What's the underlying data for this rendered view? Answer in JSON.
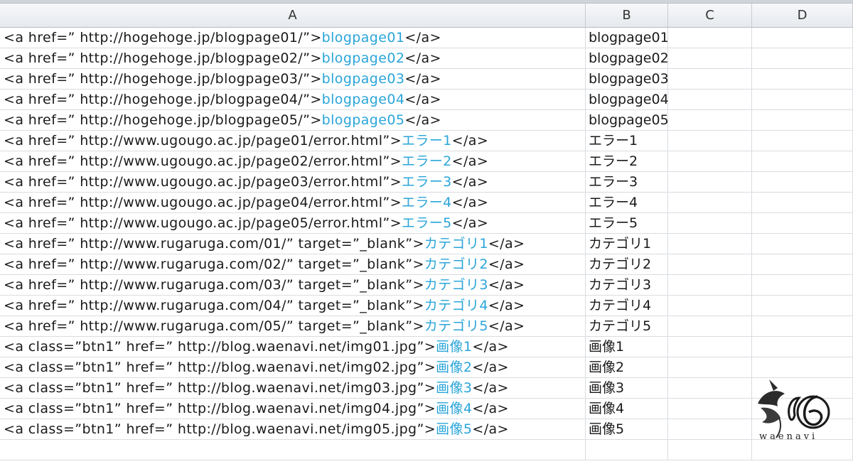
{
  "columns": [
    "A",
    "B",
    "C",
    "D"
  ],
  "rows": [
    {
      "pre": "<a href=” http://hogehoge.jp/blogpage01/”>",
      "link": "blogpage01",
      "post": "</a>",
      "b": "blogpage01"
    },
    {
      "pre": "<a href=” http://hogehoge.jp/blogpage02/”>",
      "link": "blogpage02",
      "post": "</a>",
      "b": "blogpage02"
    },
    {
      "pre": "<a href=” http://hogehoge.jp/blogpage03/”>",
      "link": "blogpage03",
      "post": "</a>",
      "b": "blogpage03"
    },
    {
      "pre": "<a href=” http://hogehoge.jp/blogpage04/”>",
      "link": "blogpage04",
      "post": "</a>",
      "b": "blogpage04"
    },
    {
      "pre": "<a href=” http://hogehoge.jp/blogpage05/”>",
      "link": "blogpage05",
      "post": "</a>",
      "b": "blogpage05"
    },
    {
      "pre": "<a href=” http://www.ugougo.ac.jp/page01/error.html”>",
      "link": "エラー1",
      "post": "</a>",
      "b": "エラー1"
    },
    {
      "pre": "<a href=” http://www.ugougo.ac.jp/page02/error.html”>",
      "link": "エラー2",
      "post": "</a>",
      "b": "エラー2"
    },
    {
      "pre": "<a href=” http://www.ugougo.ac.jp/page03/error.html”>",
      "link": "エラー3",
      "post": "</a>",
      "b": "エラー3"
    },
    {
      "pre": "<a href=” http://www.ugougo.ac.jp/page04/error.html”>",
      "link": "エラー4",
      "post": "</a>",
      "b": "エラー4"
    },
    {
      "pre": "<a href=” http://www.ugougo.ac.jp/page05/error.html”>",
      "link": "エラー5",
      "post": "</a>",
      "b": "エラー5"
    },
    {
      "pre": "<a href=” http://www.rugaruga.com/01/”  target=”_blank”>",
      "link": "カテゴリ1",
      "post": "</a>",
      "b": "カテゴリ1"
    },
    {
      "pre": "<a href=” http://www.rugaruga.com/02/”  target=”_blank”>",
      "link": "カテゴリ2",
      "post": "</a>",
      "b": "カテゴリ2"
    },
    {
      "pre": "<a href=” http://www.rugaruga.com/03/”  target=”_blank”>",
      "link": "カテゴリ3",
      "post": "</a>",
      "b": "カテゴリ3"
    },
    {
      "pre": "<a href=” http://www.rugaruga.com/04/”  target=”_blank”>",
      "link": "カテゴリ4",
      "post": "</a>",
      "b": "カテゴリ4"
    },
    {
      "pre": "<a href=” http://www.rugaruga.com/05/”  target=”_blank”>",
      "link": "カテゴリ5",
      "post": "</a>",
      "b": "カテゴリ5"
    },
    {
      "pre": "<a class=”btn1”  href=” http://blog.waenavi.net/img01.jpg”>",
      "link": "画像1",
      "post": "</a>",
      "b": "画像1"
    },
    {
      "pre": "<a class=”btn1”  href=” http://blog.waenavi.net/img02.jpg”>",
      "link": "画像2",
      "post": "</a>",
      "b": "画像2"
    },
    {
      "pre": "<a class=”btn1”  href=” http://blog.waenavi.net/img03.jpg”>",
      "link": "画像3",
      "post": "</a>",
      "b": "画像3"
    },
    {
      "pre": "<a class=”btn1”  href=” http://blog.waenavi.net/img04.jpg”>",
      "link": "画像4",
      "post": "</a>",
      "b": "画像4"
    },
    {
      "pre": "<a class=”btn1”  href=” http://blog.waenavi.net/img05.jpg”>",
      "link": "画像5",
      "post": "</a>",
      "b": "画像5"
    },
    {
      "pre": "",
      "link": "",
      "post": "",
      "b": ""
    }
  ],
  "logo": {
    "caption": "waenavi",
    "mark": "σ 6"
  },
  "colors": {
    "link": "#2aa5d9",
    "grid": "#d9dce0",
    "header_bg": "#e6e9ed"
  }
}
